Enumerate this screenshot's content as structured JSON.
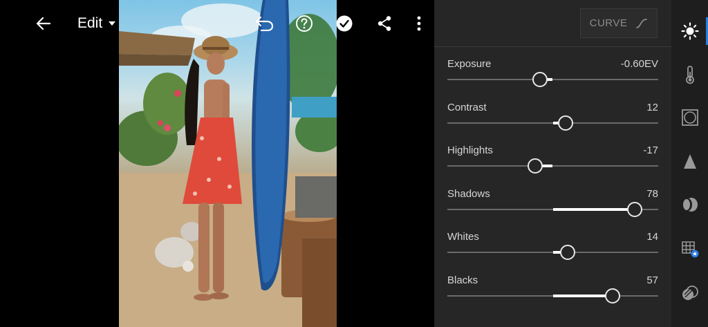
{
  "app": {
    "edit_label": "Edit",
    "curve_label": "CURVE",
    "accent_color": "#2a7de1"
  },
  "toolbar": {
    "icons": [
      "back-arrow-icon",
      "chevron-down-icon",
      "undo-icon",
      "help-icon",
      "checkmark-icon",
      "share-icon",
      "more-vertical-icon"
    ]
  },
  "adjustments": [
    {
      "name": "Exposure",
      "value": "-0.60EV",
      "level": -0.12
    },
    {
      "name": "Contrast",
      "value": "12",
      "level": 0.12
    },
    {
      "name": "Highlights",
      "value": "-17",
      "level": -0.17
    },
    {
      "name": "Shadows",
      "value": "78",
      "level": 0.78
    },
    {
      "name": "Whites",
      "value": "14",
      "level": 0.14
    },
    {
      "name": "Blacks",
      "value": "57",
      "level": 0.57
    }
  ],
  "rail": {
    "items": [
      "light-icon",
      "color-icon",
      "effects-icon",
      "detail-icon",
      "optics-icon",
      "geometry-icon",
      "presets-icon"
    ],
    "active": "light-icon"
  }
}
